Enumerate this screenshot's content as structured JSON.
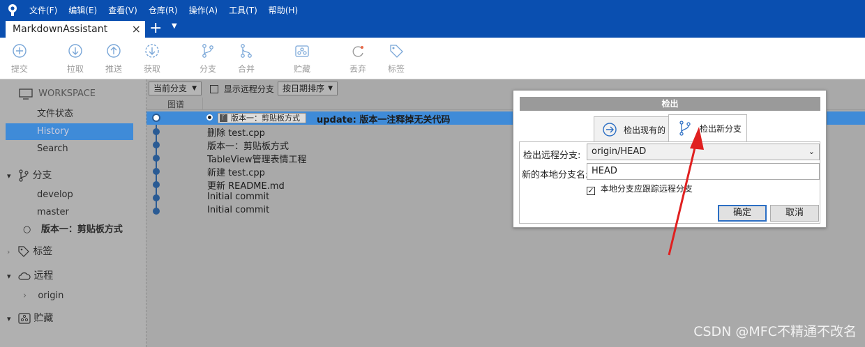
{
  "menu": [
    "文件(F)",
    "编辑(E)",
    "查看(V)",
    "仓库(R)",
    "操作(A)",
    "工具(T)",
    "帮助(H)"
  ],
  "tab": {
    "title": "MarkdownAssistant"
  },
  "toolbar": {
    "commit": "提交",
    "pull": "拉取",
    "push": "推送",
    "fetch": "获取",
    "branch": "分支",
    "merge": "合并",
    "stash": "贮藏",
    "discard": "丢弃",
    "tag": "标签"
  },
  "sidebar": {
    "workspace": "WORKSPACE",
    "file_status": "文件状态",
    "history": "History",
    "search": "Search",
    "branches": "分支",
    "branch_items": [
      "develop",
      "master",
      "版本一：剪贴板方式"
    ],
    "tags": "标签",
    "remotes": "远程",
    "remote_items": [
      "origin"
    ],
    "stashes": "贮藏"
  },
  "filter": {
    "branch_select": "当前分支",
    "show_remote": "显示远程分支",
    "sort": "按日期排序"
  },
  "columns": {
    "graph": "图谱"
  },
  "commits": [
    {
      "tag": "版本一：剪贴板方式",
      "message": "update: 版本一注释掉无关代码"
    },
    {
      "message": "删除 test.cpp"
    },
    {
      "message": "版本一：剪贴板方式"
    },
    {
      "message": "TableView管理表情工程"
    },
    {
      "message": "新建 test.cpp"
    },
    {
      "message": "更新 README.md"
    },
    {
      "message": "Initial commit"
    },
    {
      "message": "Initial commit"
    }
  ],
  "dialog": {
    "title": "检出",
    "tab_existing": "检出现有的",
    "tab_new": "检出新分支",
    "remote_label": "检出远程分支:",
    "remote_value": "origin/HEAD",
    "local_label": "新的本地分支名:",
    "local_value": "HEAD",
    "track_label": "本地分支应跟踪远程分支",
    "ok": "确定",
    "cancel": "取消"
  },
  "watermark": "CSDN @MFC不精通不改名",
  "colors": {
    "accent": "#0a4fb0",
    "selected_row": "#3f8bd8",
    "arrow": "#e02020"
  }
}
